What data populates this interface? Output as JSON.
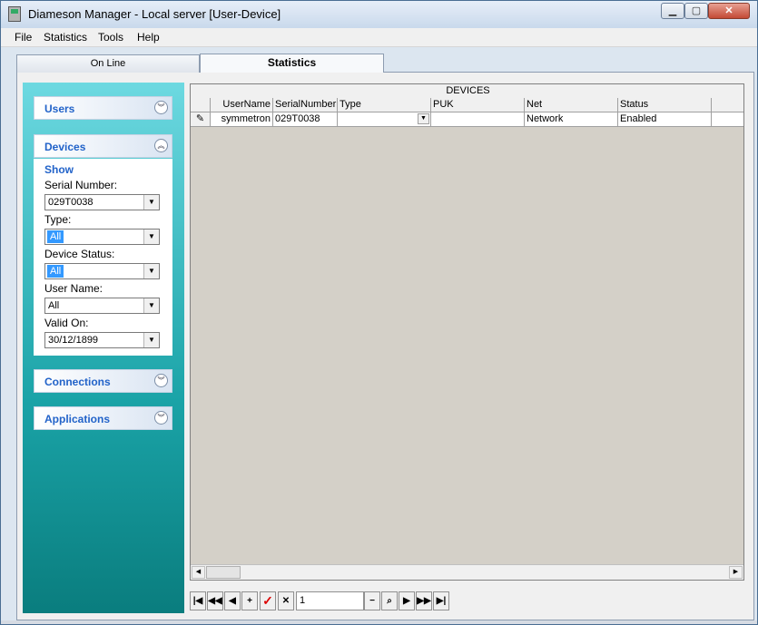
{
  "window": {
    "title": "Diameson Manager - Local server [User-Device]",
    "min_glyph": "▁",
    "max_glyph": "▢",
    "close_glyph": "✕"
  },
  "menu": {
    "items": [
      "File",
      "Statistics",
      "Tools",
      "Help"
    ]
  },
  "tabs": [
    {
      "label": "On Line"
    },
    {
      "label": "Statistics",
      "active": true
    }
  ],
  "sidebar": {
    "users": {
      "title": "Users"
    },
    "devices": {
      "title": "Devices",
      "show_label": "Show",
      "serial_label": "Serial Number:",
      "serial_value": "029T0038",
      "type_label": "Type:",
      "type_value": "All",
      "status_label": "Device Status:",
      "status_value": "All",
      "username_label": "User Name:",
      "username_value": "All",
      "valid_label": "Valid On:",
      "valid_value": "30/12/1899"
    },
    "connections": {
      "title": "Connections"
    },
    "applications": {
      "title": "Applications"
    }
  },
  "grid": {
    "title": "DEVICES",
    "columns": [
      "UserName",
      "SerialNumber",
      "Type",
      "PUK",
      "Net",
      "Status"
    ],
    "rows": [
      {
        "indicator": "✎",
        "cells": [
          "symmetron",
          "029T0038",
          "",
          "",
          "Network",
          "Enabled"
        ]
      }
    ]
  },
  "navigator": {
    "position": "1"
  },
  "colors": {
    "accent": "#2263c9",
    "sidebar_top": "#6dd9e1",
    "sidebar_bottom": "#0a7d7e",
    "grid_bg": "#d4d0c8"
  }
}
